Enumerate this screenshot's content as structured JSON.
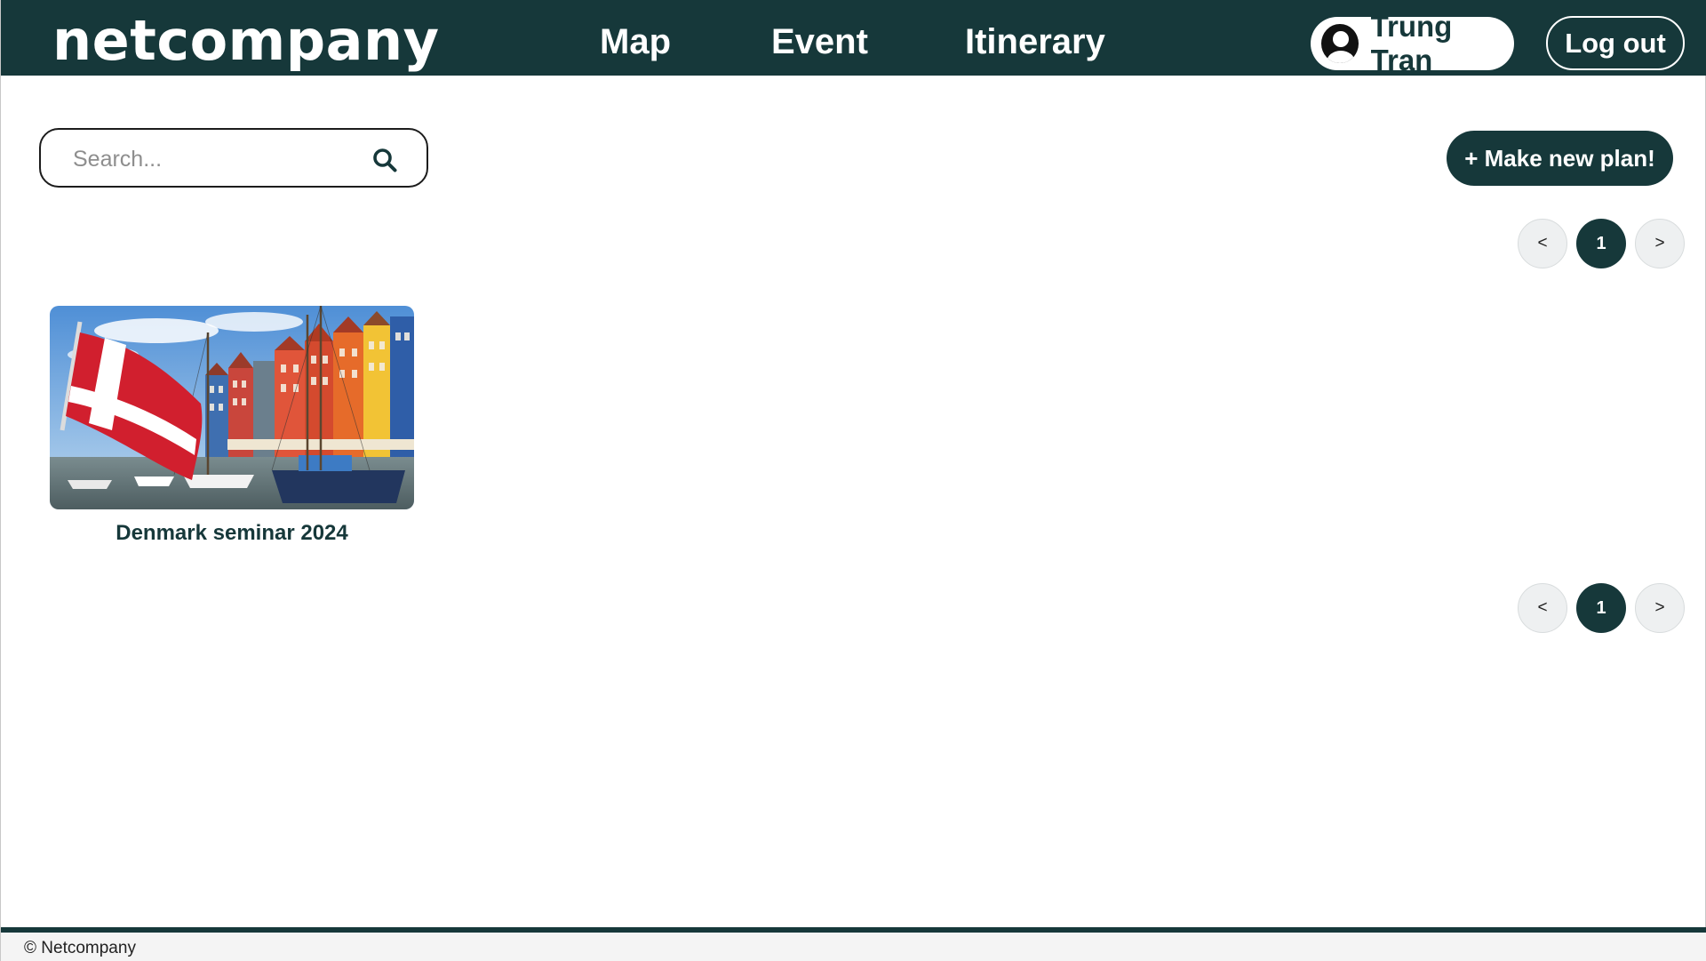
{
  "header": {
    "logo": "netcompany",
    "nav": {
      "map": "Map",
      "event": "Event",
      "itinerary": "Itinerary"
    },
    "user_name": "Trung Tran",
    "logout_label": "Log out"
  },
  "search": {
    "placeholder": "Search...",
    "value": ""
  },
  "make_plan_label": "+ Make new plan!",
  "pagination": {
    "prev": "<",
    "current": "1",
    "next": ">"
  },
  "plans": [
    {
      "title": "Denmark seminar 2024"
    }
  ],
  "footer": {
    "text": "© Netcompany"
  },
  "colors": {
    "brand": "#16383a",
    "background": "#ffffff"
  }
}
